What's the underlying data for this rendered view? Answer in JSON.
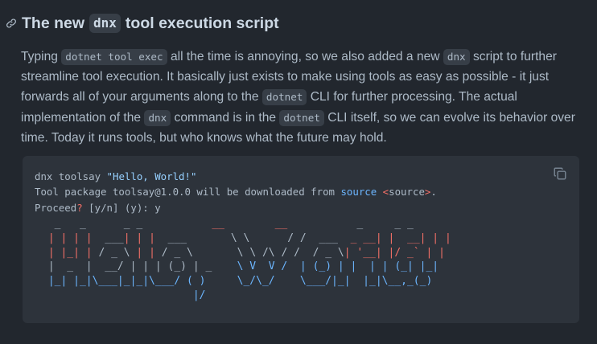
{
  "heading": {
    "before": "The new",
    "code": "dnx",
    "after": "tool execution script"
  },
  "paragraph": {
    "t1": "Typing ",
    "c1": "dotnet tool exec",
    "t2": " all the time is annoying, so we also added a new ",
    "c2": "dnx",
    "t3": " script to further streamline tool execution. It basically just exists to make using tools as easy as possible - it just forwards all of your arguments along to the ",
    "c3": "dotnet",
    "t4": " CLI for further processing. The actual implementation of the ",
    "c4": "dnx",
    "t5": " command is in the ",
    "c5": "dotnet",
    "t6": " CLI itself, so we can evolve its behavior over time. Today it runs tools, but who knows what the future may hold."
  },
  "code": {
    "cmd": "dnx toolsay ",
    "cmd_arg": "\"Hello, World!\"",
    "msg_prefix": "Tool package toolsay@1.0.0 will be downloaded from ",
    "msg_source": "source",
    "msg_lt": " <",
    "msg_source_word": "source",
    "msg_gt": ">",
    "msg_end": ".",
    "proceed": "Proceed",
    "qmark": "?",
    "options": " [y/n] (y): y"
  },
  "ascii_art": [
    [
      [
        "",
        "  _   _      _ _           "
      ],
      [
        "red",
        "__"
      ],
      [
        "",
        "        "
      ],
      [
        "red",
        "__"
      ],
      [
        "",
        "           _     _ _ "
      ]
    ],
    [
      [
        "red",
        " | | | |  "
      ],
      [
        "",
        "___"
      ],
      [
        "red",
        "| | |"
      ],
      [
        "",
        "  ___  "
      ],
      [
        "",
        "     \\ \\      / /"
      ],
      [
        "",
        "  ___  "
      ],
      [
        "red",
        "_ __| |  __| | |"
      ]
    ],
    [
      [
        "red",
        " | |_| |"
      ],
      [
        "",
        " / _ \\"
      ],
      [
        "red",
        " | |"
      ],
      [
        "",
        " / _ \\ "
      ],
      [
        "",
        "      \\ \\ /\\ / /"
      ],
      [
        "",
        "  / _ \\"
      ],
      [
        "red",
        "| '__| |/ _` | |"
      ]
    ],
    [
      [
        "",
        " |  _  |  __/ | | | (_) | _   "
      ],
      [
        "blue",
        " \\ V  V /"
      ],
      [
        "blue",
        "  | (_) | |  | | (_| |_|"
      ]
    ],
    [
      [
        "blue",
        " |_| |_|\\___|_|_|\\___/ ( )  "
      ],
      [
        "blue",
        "   \\_/\\_/"
      ],
      [
        "blue",
        "    \\___/|_|  |_|\\__,_(_)"
      ]
    ],
    [
      [
        "blue",
        "                        |/"
      ]
    ]
  ]
}
